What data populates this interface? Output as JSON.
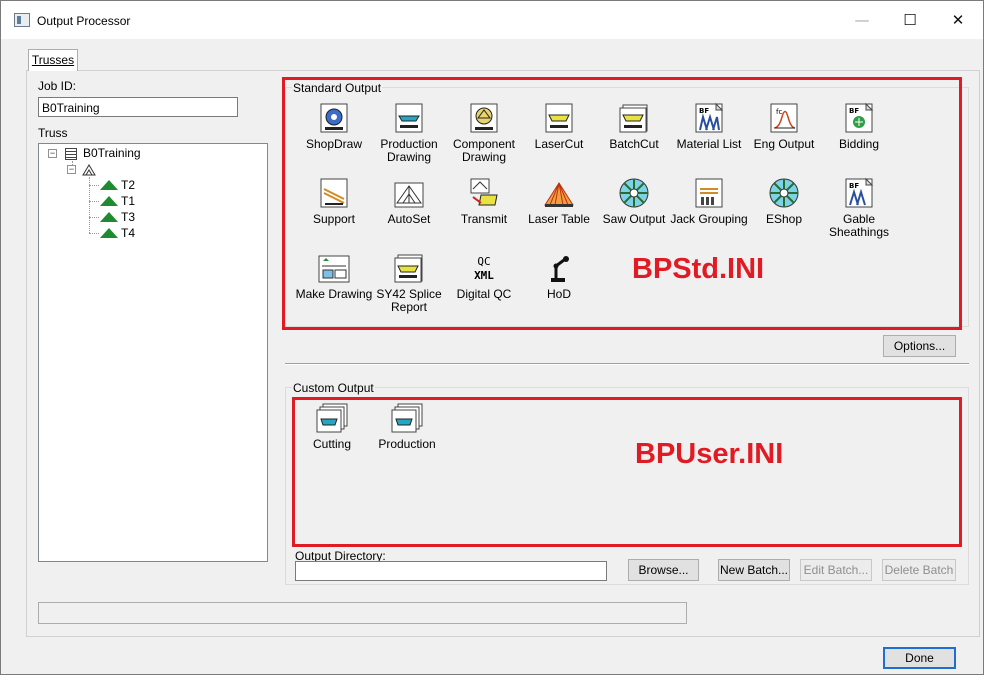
{
  "window": {
    "title": "Output Processor",
    "min": "—",
    "max": "☐",
    "close": "✕"
  },
  "tab": {
    "label": "Trusses"
  },
  "job": {
    "label": "Job ID:",
    "value": "B0Training"
  },
  "truss": {
    "label": "Truss",
    "root": "B0Training",
    "items": [
      "T2",
      "T1",
      "T3",
      "T4"
    ]
  },
  "standard_output": {
    "label": "Standard Output",
    "annotation": "BPStd.INI",
    "items": [
      {
        "label": "ShopDraw",
        "icon": "shopdraw-icon"
      },
      {
        "label": "Production Drawing",
        "icon": "production-drawing-icon"
      },
      {
        "label": "Component Drawing",
        "icon": "component-drawing-icon"
      },
      {
        "label": "LaserCut",
        "icon": "lasercut-icon"
      },
      {
        "label": "BatchCut",
        "icon": "batchcut-icon"
      },
      {
        "label": "Material List",
        "icon": "material-list-icon"
      },
      {
        "label": "Eng Output",
        "icon": "eng-output-icon"
      },
      {
        "label": "Bidding",
        "icon": "bidding-icon"
      },
      {
        "label": "Support",
        "icon": "support-icon"
      },
      {
        "label": "AutoSet",
        "icon": "autoset-icon"
      },
      {
        "label": "Transmit",
        "icon": "transmit-icon"
      },
      {
        "label": "Laser Table",
        "icon": "laser-table-icon"
      },
      {
        "label": "Saw Output",
        "icon": "saw-output-icon"
      },
      {
        "label": "Jack Grouping",
        "icon": "jack-grouping-icon"
      },
      {
        "label": "EShop",
        "icon": "eshop-icon"
      },
      {
        "label": "Gable Sheathings",
        "icon": "gable-sheathings-icon"
      },
      {
        "label": "Make Drawing",
        "icon": "make-drawing-icon"
      },
      {
        "label": "SY42 Splice Report",
        "icon": "sy42-splice-report-icon"
      },
      {
        "label": "Digital QC",
        "icon": "digital-qc-icon",
        "icon_text": "QC\nXML"
      },
      {
        "label": "HoD",
        "icon": "hod-icon"
      }
    ],
    "options_button": "Options..."
  },
  "custom_output": {
    "label": "Custom Output",
    "annotation": "BPUser.INI",
    "items": [
      {
        "label": "Cutting",
        "icon": "cutting-icon"
      },
      {
        "label": "Production",
        "icon": "production-icon"
      }
    ]
  },
  "output_directory": {
    "label": "Output Directory:",
    "value": ""
  },
  "buttons": {
    "browse": "Browse...",
    "new_batch": "New Batch...",
    "edit_batch": "Edit Batch...",
    "delete_batch": "Delete Batch",
    "done": "Done"
  },
  "colors": {
    "highlight": "#e01b24",
    "truss_green": "#1e8c2e",
    "default_button_border": "#1f6fd1"
  }
}
